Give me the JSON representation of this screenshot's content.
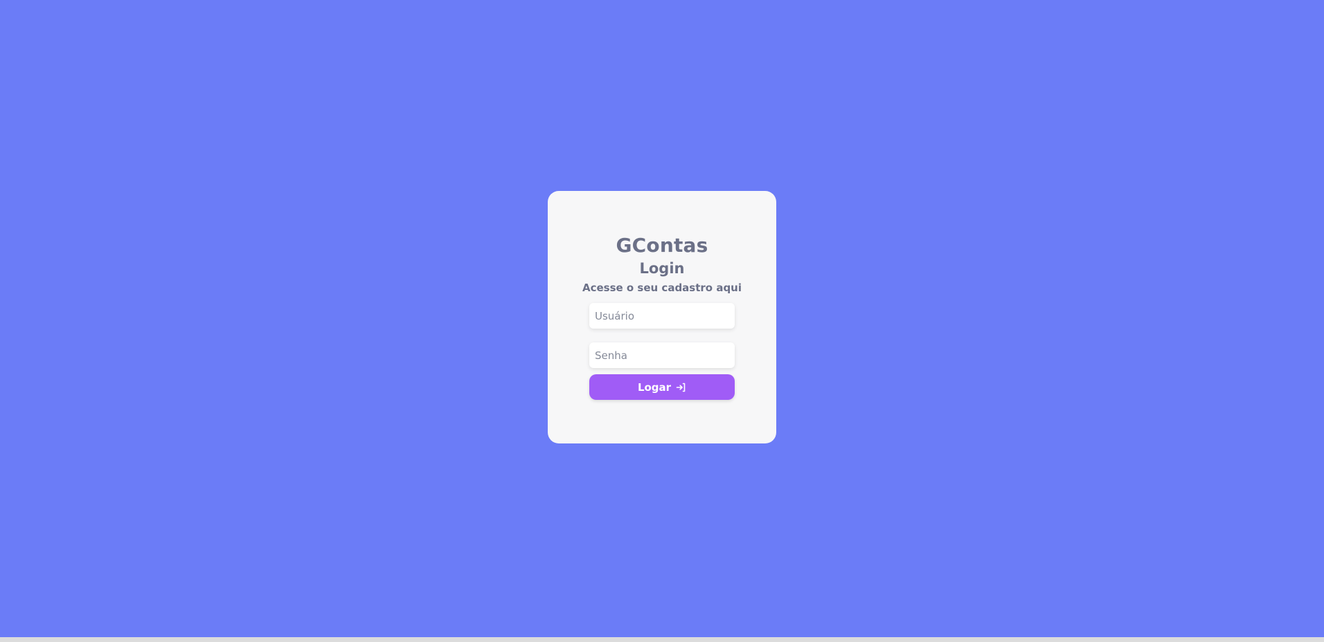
{
  "app": {
    "brand": "GContas",
    "title": "Login",
    "subtitle": "Acesse o seu cadastro aqui"
  },
  "form": {
    "username": {
      "placeholder": "Usuário",
      "value": ""
    },
    "password": {
      "placeholder": "Senha",
      "value": ""
    },
    "submit_label": "Logar",
    "submit_icon": "login-arrow-icon"
  },
  "colors": {
    "background": "#6b7cf7",
    "card": "#f7f7f8",
    "button": "#a05cf6",
    "text": "#6b7087"
  }
}
